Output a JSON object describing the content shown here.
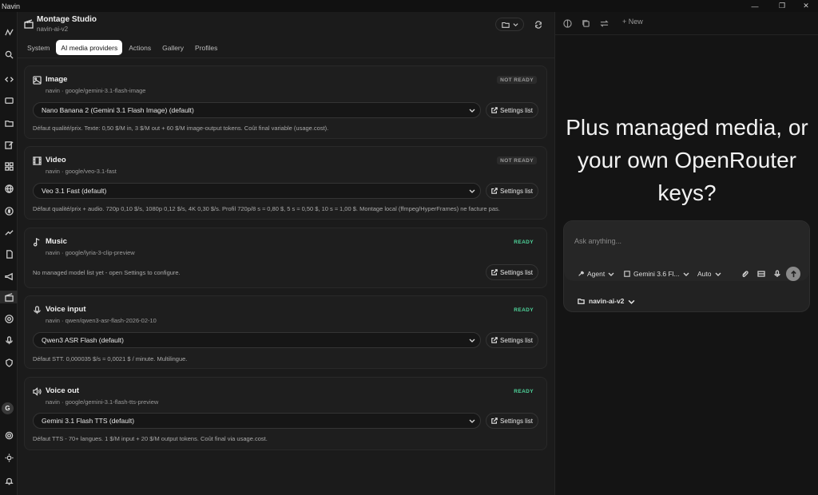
{
  "window": {
    "app_name": "Navin",
    "minimize": "—",
    "maximize": "❐",
    "close": "✕"
  },
  "header": {
    "title": "Montage Studio",
    "subtitle": "navin-ai-v2"
  },
  "tabs": [
    {
      "label": "System",
      "active": false
    },
    {
      "label": "AI media providers",
      "active": true
    },
    {
      "label": "Actions",
      "active": false
    },
    {
      "label": "Gallery",
      "active": false
    },
    {
      "label": "Profiles",
      "active": false
    }
  ],
  "providers": [
    {
      "icon": "image-icon",
      "title": "Image",
      "meta": "navin · google/gemini-3.1-flash-image",
      "status": "NOT READY",
      "select": "Nano Banana 2 (Gemini 3.1 Flash Image) (default)",
      "settings_label": "Settings list",
      "note": "Défaut qualité/prix. Texte: 0,50 $/M in, 3 $/M out + 60 $/M image-output tokens. Coût final variable (usage.cost)."
    },
    {
      "icon": "film-icon",
      "title": "Video",
      "meta": "navin · google/veo-3.1-fast",
      "status": "NOT READY",
      "select": "Veo 3.1 Fast (default)",
      "settings_label": "Settings list",
      "note": "Défaut qualité/prix + audio. 720p 0,10 $/s, 1080p 0,12 $/s, 4K 0,30 $/s. Profil 720p/8 s ≈ 0,80 $, 5 s ≈ 0,50 $, 10 s ≈ 1,00 $. Montage local (ffmpeg/HyperFrames) ne facture pas."
    },
    {
      "icon": "music-icon",
      "title": "Music",
      "meta": "navin · google/lyria-3-clip-preview",
      "status": "READY",
      "select": "",
      "settings_label": "Settings list",
      "note": "No managed model list yet - open Settings to configure."
    },
    {
      "icon": "mic-icon",
      "title": "Voice input",
      "meta": "navin · qwen/qwen3-asr-flash-2026-02-10",
      "status": "READY",
      "select": "Qwen3 ASR Flash (default)",
      "settings_label": "Settings list",
      "note": "Défaut STT. 0,000035 $/s ≈ 0,0021 $ / minute. Multilingue."
    },
    {
      "icon": "speaker-icon",
      "title": "Voice out",
      "meta": "navin · google/gemini-3.1-flash-tts-preview",
      "status": "READY",
      "select": "Gemini 3.1 Flash TTS (default)",
      "settings_label": "Settings list",
      "note": "Défaut TTS - 70+ langues. 1 $/M input + 20 $/M output tokens. Coût final via usage.cost."
    }
  ],
  "rail": {
    "avatar": "G"
  },
  "right": {
    "new_label": "+ New",
    "hero": "Plus managed media, or your own OpenRouter keys?",
    "composer": {
      "placeholder": "Ask anything...",
      "mode": "Agent",
      "model": "Gemini 3.6 Fl...",
      "reasoning": "Auto",
      "project": "navin-ai-v2"
    }
  },
  "colors": {
    "ready": "#4fd69c",
    "accent_tab_bg": "#ffffff",
    "background": "#1b1b1b"
  }
}
